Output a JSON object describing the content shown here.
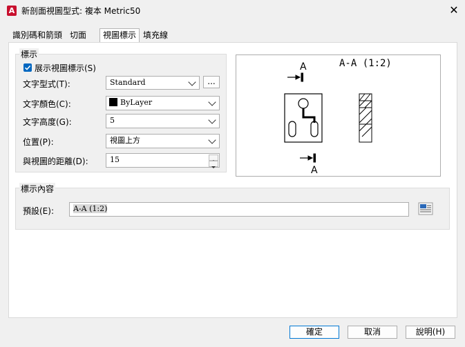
{
  "window": {
    "title": "新剖面視圖型式: 複本 Metric50",
    "app_icon": "A"
  },
  "tabs": [
    {
      "label": "識別碼和箭頭"
    },
    {
      "label": "切面"
    },
    {
      "label": "視圖標示"
    },
    {
      "label": "填充線"
    }
  ],
  "label_group": {
    "title": "標示",
    "show_label": {
      "label": "展示視圖標示(S)",
      "checked": true
    },
    "text_style": {
      "label": "文字型式(T):",
      "value": "Standard",
      "browse_label": "..."
    },
    "text_color": {
      "label": "文字顏色(C):",
      "value": "ByLayer",
      "swatch": "#000000"
    },
    "text_height": {
      "label": "文字高度(G):",
      "value": "5"
    },
    "location": {
      "label": "位置(P):",
      "value": "視圖上方"
    },
    "distance": {
      "label": "與視圖的距離(D):",
      "value": "15"
    }
  },
  "preview": {
    "label_top": "A",
    "title": "A-A (1:2)",
    "label_bottom": "A"
  },
  "contents_group": {
    "title": "標示內容",
    "default_label": "預設(E):",
    "default_value": "A-A (1:2)"
  },
  "footer": {
    "ok": "確定",
    "cancel": "取消",
    "help": "說明(H)"
  }
}
